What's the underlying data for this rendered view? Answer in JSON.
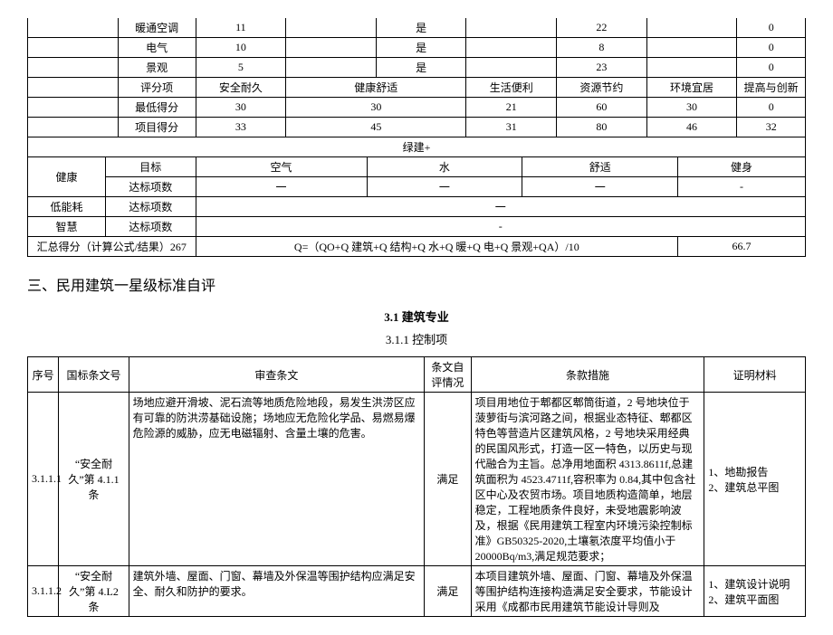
{
  "topRows": [
    {
      "cat": "暖通空调",
      "v1": "11",
      "v2": "",
      "v3": "是",
      "v4": "",
      "v5": "22",
      "v6": "",
      "v7": "0"
    },
    {
      "cat": "电气",
      "v1": "10",
      "v2": "",
      "v3": "是",
      "v4": "",
      "v5": "8",
      "v6": "",
      "v7": "0"
    },
    {
      "cat": "景观",
      "v1": "5",
      "v2": "",
      "v3": "是",
      "v4": "",
      "v5": "23",
      "v6": "",
      "v7": "0"
    }
  ],
  "scoreHeader": {
    "cat": "评分项",
    "c1": "安全耐久",
    "c2": "健康舒适",
    "c3": "生活便利",
    "c4": "资源节约",
    "c5": "环境宜居",
    "c6": "提高与创新"
  },
  "scoreRows": [
    {
      "cat": "最低得分",
      "c1": "30",
      "c2": "30",
      "c3": "21",
      "c4": "60",
      "c5": "30",
      "c6": "0"
    },
    {
      "cat": "项目得分",
      "c1": "33",
      "c2": "45",
      "c3": "31",
      "c4": "80",
      "c5": "46",
      "c6": "32"
    }
  ],
  "greenPlus": {
    "title": "绿建+"
  },
  "g2": {
    "r1": {
      "c1": "健康",
      "c2": "目标",
      "c3": "空气",
      "c4": "水",
      "c5": "舒适",
      "c6": "健身"
    },
    "r2": {
      "c2": "达标项数",
      "c3": "一",
      "c4": "一",
      "c5": "一",
      "c6": "-"
    },
    "r3": {
      "c1": "低能耗",
      "c2": "达标项数",
      "c3": "一"
    },
    "r4": {
      "c1": "智慧",
      "c2": "达标项数",
      "c3": "-"
    },
    "r5": {
      "c1": "汇总得分（计算公式/结果）267",
      "c2": "Q=（QO+Q 建筑+Q 结构+Q 水+Q 暖+Q 电+Q 景观+QA）/10",
      "c3": "66.7"
    }
  },
  "heading2": "三、民用建筑一星级标准自评",
  "heading3": "3.1 建筑专业",
  "heading4": "3.1.1 控制项",
  "cols": {
    "xh": "序号",
    "gh": "国标条文号",
    "sc": "审查条文",
    "zp": "条文自评情况",
    "cs": "条款措施",
    "zm": "证明材料"
  },
  "item1": {
    "xh": "3.1.1.1",
    "gh": "“安全耐久”第 4.1.1 条",
    "sc": "场地应避开滑坡、泥石流等地质危险地段，易发生洪涝区应有可靠的防洪涝基础设施；场地应无危险化学品、易燃易爆危险源的威胁，应无电磁辐射、含量土壤的危害。",
    "zp": "满足",
    "cs": "项目用地位于郫都区郫筒街道，2 号地块位于菠萝街与滨河路之间，根据业态特征、郫都区特色等营造片区建筑风格，2 号地块采用经典的民国风形式，打造一区一特色，以历史与现代融合为主旨。总净用地面积 4313.8611f,总建筑面积为 4523.4711f,容积率为 0.84,其中包含社区中心及农贸市场。项目地质构造简单，地层稳定，工程地质条件良好，未受地震影响波及，根据《民用建筑工程室内环境污染控制标准》GB50325-2020,土壤氡浓度平均值小于20000Bq/m3,满足规范要求；",
    "zm": "1、地勘报告\n2、建筑总平图"
  },
  "item2": {
    "xh": "3.1.1.2",
    "gh": "“安全耐久”第 4.L2 条",
    "sc": "建筑外墙、屋面、门窗、幕墙及外保温等围护结构应满足安全、耐久和防护的要求。",
    "zp": "满足",
    "cs": "本项目建筑外墙、屋面、门窗、幕墙及外保温等围护结构连接构造满足安全要求，节能设计采用《成都市民用建筑节能设计导则及",
    "zm": "1、建筑设计说明\n2、建筑平面图"
  }
}
